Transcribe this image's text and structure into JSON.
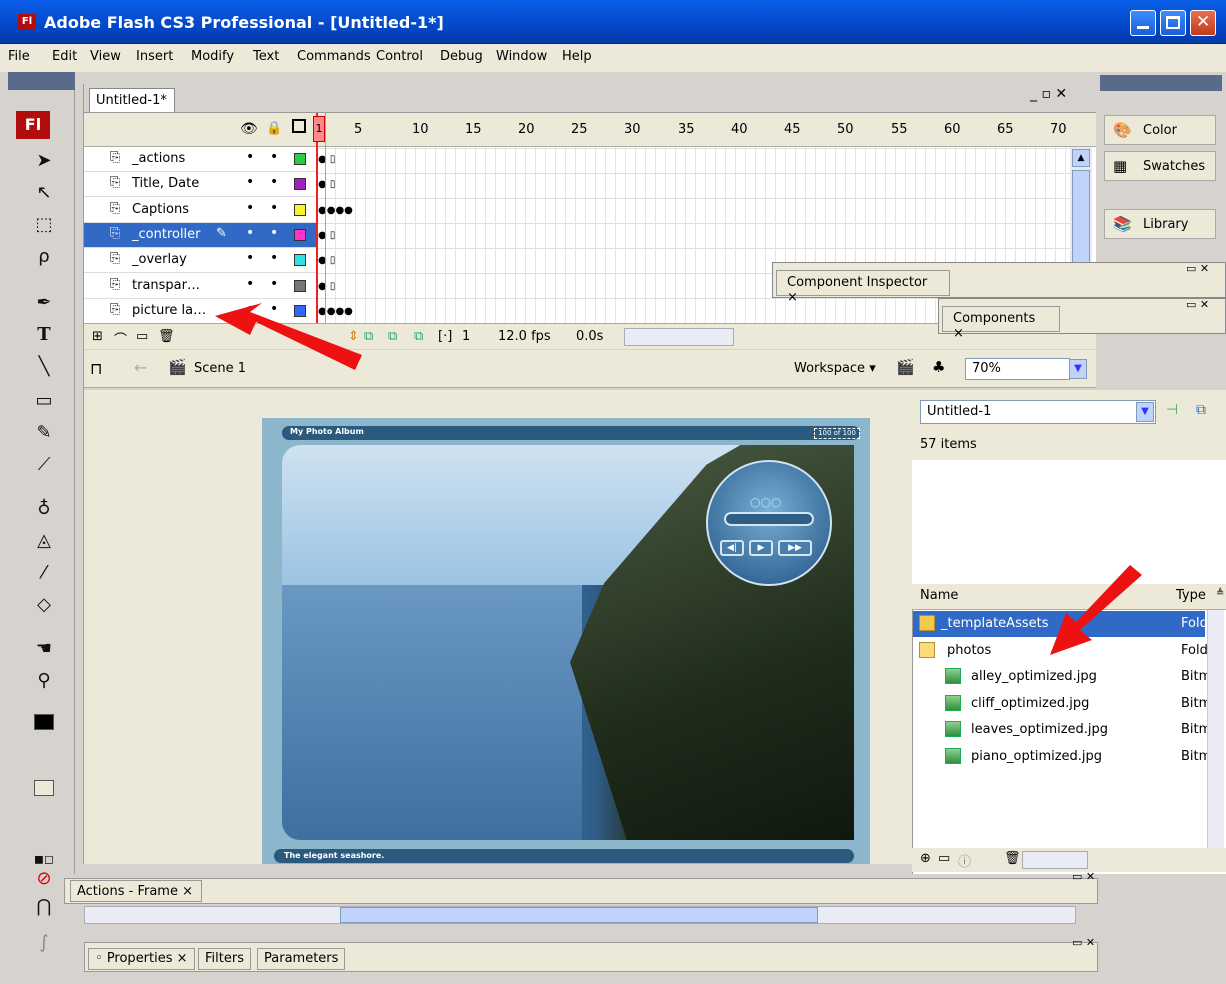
{
  "window": {
    "title": "Adobe Flash CS3 Professional - [Untitled-1*]",
    "icon": "Fl"
  },
  "menu": [
    "File",
    "Edit",
    "View",
    "Insert",
    "Modify",
    "Text",
    "Commands",
    "Control",
    "Debug",
    "Window",
    "Help"
  ],
  "document_tab": "Untitled-1*",
  "timeline": {
    "frame_ticks": [
      "1",
      "5",
      "10",
      "15",
      "20",
      "25",
      "30",
      "35",
      "40",
      "45",
      "50",
      "55",
      "60",
      "65",
      "70"
    ],
    "layers": [
      {
        "name": "_actions",
        "color": "#2ecc40",
        "selected": false
      },
      {
        "name": "Title, Date",
        "color": "#a020c0",
        "selected": false
      },
      {
        "name": "Captions",
        "color": "#f5f52a",
        "selected": false
      },
      {
        "name": "_controller",
        "color": "#ff33cc",
        "selected": true
      },
      {
        "name": "_overlay",
        "color": "#33e0e0",
        "selected": false
      },
      {
        "name": "transpar…",
        "color": "#777777",
        "selected": false
      },
      {
        "name": "picture la…",
        "color": "#3366ff",
        "selected": false
      }
    ],
    "footer": {
      "frame": "1",
      "fps": "12.0 fps",
      "time": "0.0s"
    }
  },
  "editbar": {
    "scene": "Scene 1",
    "workspace": "Workspace ▾",
    "zoom": "70%"
  },
  "stage": {
    "album_title": "My Photo Album",
    "counter": "100 of 100",
    "caption": "The elegant seashore."
  },
  "right_panels": {
    "color": "Color",
    "swatches": "Swatches",
    "library": "Library"
  },
  "floating": {
    "component_inspector": "Component Inspector",
    "components": "Components"
  },
  "library": {
    "doc": "Untitled-1",
    "count": "57 items",
    "col_name": "Name",
    "col_type": "Type",
    "items": [
      {
        "name": "_templateAssets",
        "type": "Fold",
        "kind": "folder",
        "selected": true
      },
      {
        "name": "photos",
        "type": "Fold",
        "kind": "folder-open",
        "selected": false
      },
      {
        "name": "alley_optimized.jpg",
        "type": "Bitm",
        "kind": "bitmap",
        "selected": false
      },
      {
        "name": "cliff_optimized.jpg",
        "type": "Bitm",
        "kind": "bitmap",
        "selected": false
      },
      {
        "name": "leaves_optimized.jpg",
        "type": "Bitm",
        "kind": "bitmap",
        "selected": false
      },
      {
        "name": "piano_optimized.jpg",
        "type": "Bitm",
        "kind": "bitmap",
        "selected": false
      }
    ]
  },
  "bottom": {
    "actions": "Actions - Frame",
    "tabs": [
      "Properties",
      "Filters",
      "Parameters"
    ]
  },
  "colors": {
    "selection": "#3169c6",
    "titlebar": "#0348c9",
    "annotation_arrow": "#ee1111"
  }
}
